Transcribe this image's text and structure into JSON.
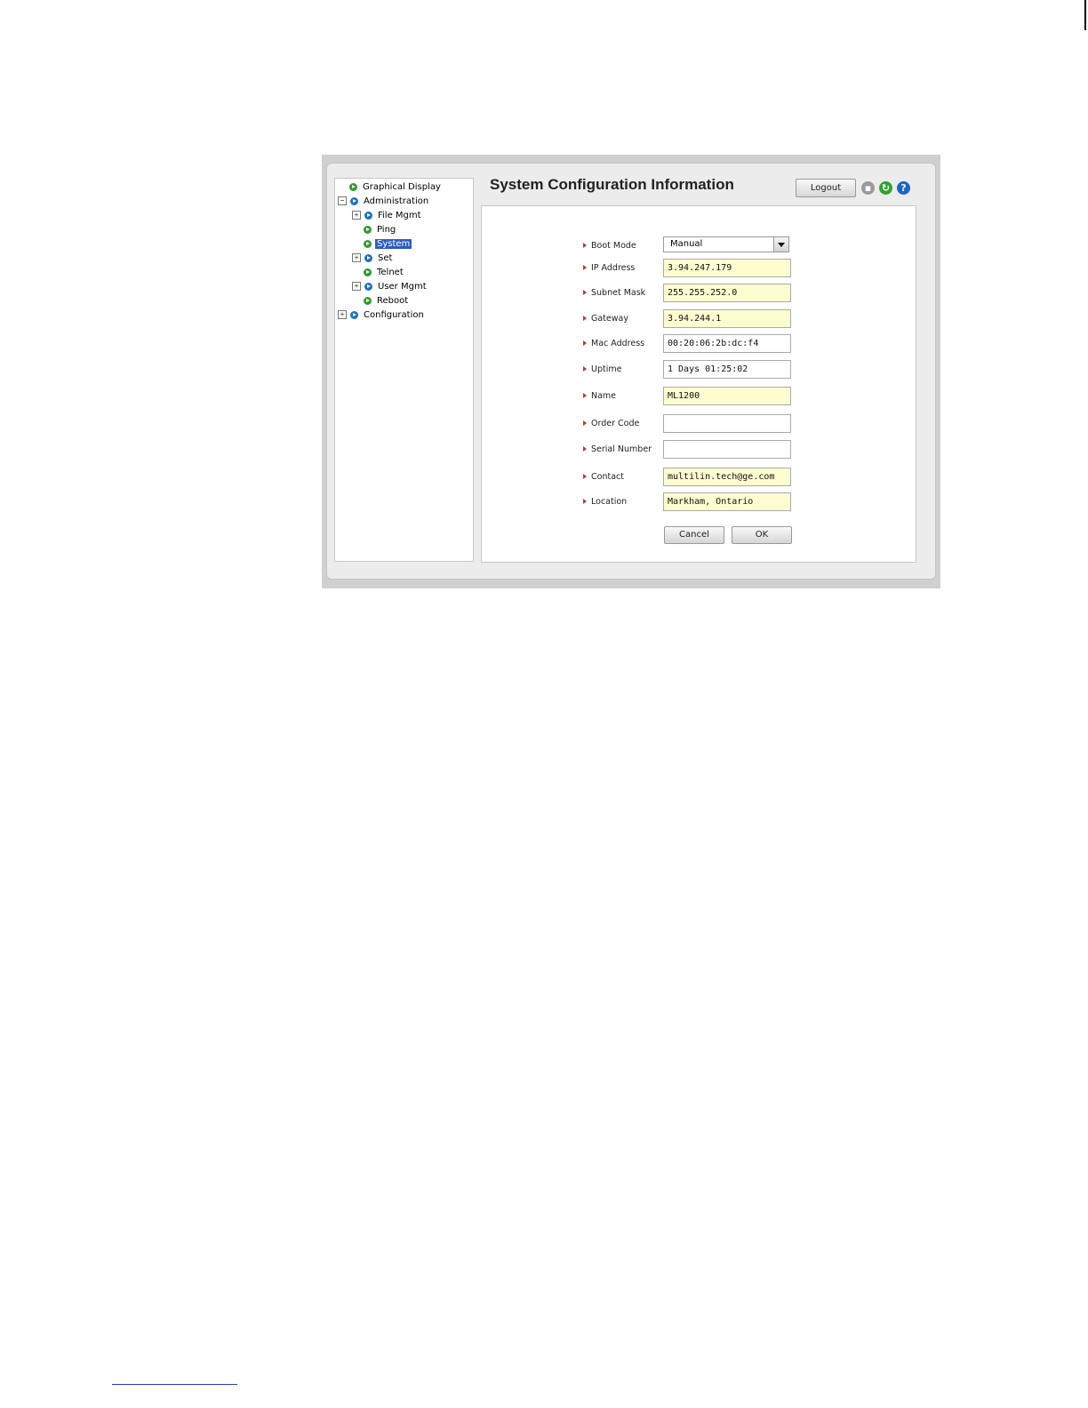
{
  "window": {
    "title": "System Configuration Information",
    "logout_label": "Logout"
  },
  "icons": {
    "save": "save-icon",
    "refresh": "refresh-icon",
    "help": "help-icon"
  },
  "tree": {
    "items": [
      {
        "label": "Graphical Display",
        "expander": "",
        "icon": "green"
      },
      {
        "label": "Administration",
        "expander": "−",
        "icon": "blue"
      },
      {
        "label": "File Mgmt",
        "expander": "+",
        "icon": "blue"
      },
      {
        "label": "Ping",
        "expander": "",
        "icon": "green"
      },
      {
        "label": "System",
        "expander": "",
        "icon": "green",
        "selected": true
      },
      {
        "label": "Set",
        "expander": "+",
        "icon": "blue"
      },
      {
        "label": "Telnet",
        "expander": "",
        "icon": "green"
      },
      {
        "label": "User Mgmt",
        "expander": "+",
        "icon": "blue"
      },
      {
        "label": "Reboot",
        "expander": "",
        "icon": "green"
      },
      {
        "label": "Configuration",
        "expander": "+",
        "icon": "blue"
      }
    ]
  },
  "form": {
    "boot_mode": {
      "label": "Boot Mode",
      "value": "Manual"
    },
    "ip_address": {
      "label": "IP Address",
      "value": "3.94.247.179"
    },
    "subnet_mask": {
      "label": "Subnet Mask",
      "value": "255.255.252.0"
    },
    "gateway": {
      "label": "Gateway",
      "value": "3.94.244.1"
    },
    "mac_address": {
      "label": "Mac Address",
      "value": "00:20:06:2b:dc:f4"
    },
    "uptime": {
      "label": "Uptime",
      "value": "1 Days 01:25:02"
    },
    "name": {
      "label": "Name",
      "value": "ML1200"
    },
    "order_code": {
      "label": "Order Code",
      "value": ""
    },
    "serial_number": {
      "label": "Serial Number",
      "value": ""
    },
    "contact": {
      "label": "Contact",
      "value": "multilin.tech@ge.com"
    },
    "location": {
      "label": "Location",
      "value": "Markham, Ontario"
    },
    "cancel_label": "Cancel",
    "ok_label": "OK"
  }
}
